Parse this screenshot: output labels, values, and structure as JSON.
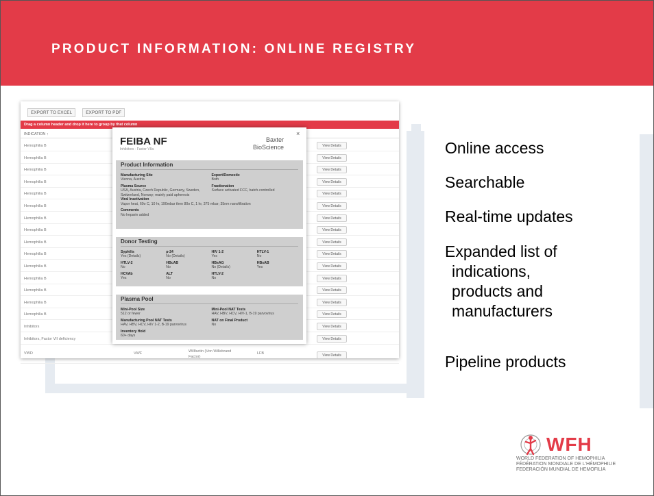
{
  "slide": {
    "title": "PRODUCT INFORMATION: ONLINE REGISTRY",
    "accent_color": "#e33b48"
  },
  "registry": {
    "toolbar": [
      "EXPORT TO EXCEL",
      "EXPORT TO PDF"
    ],
    "group_hint": "Drag a column header and drop it here to group by that column",
    "header": "INDICATION ↑",
    "view_details": "View Details",
    "rows": [
      {
        "indication": "Hemophilia B"
      },
      {
        "indication": "Hemophilia B"
      },
      {
        "indication": "Hemophilia B"
      },
      {
        "indication": "Hemophilia B"
      },
      {
        "indication": "Hemophilia B"
      },
      {
        "indication": "Hemophilia B"
      },
      {
        "indication": "Hemophilia B"
      },
      {
        "indication": "Hemophilia B"
      },
      {
        "indication": "Hemophilia B"
      },
      {
        "indication": "Hemophilia B"
      },
      {
        "indication": "Hemophilia B"
      },
      {
        "indication": "Hemophilia B"
      },
      {
        "indication": "Hemophilia B"
      },
      {
        "indication": "Hemophilia B"
      },
      {
        "indication": "Hemophilia B"
      },
      {
        "indication": "Inhibitors"
      },
      {
        "indication": "Inhibitors, Factor VII deficiency"
      }
    ],
    "last_row": {
      "indication": "VWD",
      "type": "VWF",
      "desc": "Willfactin (Von Willebrand Factor)",
      "maker": "LFB"
    }
  },
  "modal": {
    "close": "×",
    "product": "FEIBA NF",
    "subtitle": "Inhibitors - Factor VIIa",
    "company_line1": "Baxter",
    "company_line2": "BioScience",
    "info": {
      "heading": "Product Information",
      "site_label": "Manufacturing Site",
      "site": "Vienna, Austria",
      "export_label": "Export/Domestic",
      "export": "Both",
      "source_label": "Plasma Source",
      "source": "USA, Austria, Czech Republic, Germany, Sweden, Switzerland, Norway; mainly paid apheresis",
      "fraction_label": "Fractionation",
      "fraction": "Surface activated FCC, batch-controlled",
      "viral_label": "Viral Inactivation",
      "viral": "Vapor heat, 60o C, 10 hr, 190mbar then 80o C, 1 hr, 375 mbar; 35nm nanofiltration",
      "comments_label": "Comments",
      "comments": "No heparin added"
    },
    "donor": {
      "heading": "Donor Testing",
      "items": [
        {
          "label": "Syphilis",
          "value": "Yes (Details)"
        },
        {
          "label": "p-24",
          "value": "No (Details)"
        },
        {
          "label": "HIV 1-2",
          "value": "Yes"
        },
        {
          "label": "HTLV-1",
          "value": "No"
        },
        {
          "label": "HTLV-2",
          "value": "No"
        },
        {
          "label": "HBcAB",
          "value": "No"
        },
        {
          "label": "HBsAG",
          "value": "No (Details)"
        },
        {
          "label": "HBsAB",
          "value": "Yes"
        },
        {
          "label": "HCVAb",
          "value": "Yes"
        },
        {
          "label": "ALT",
          "value": "No"
        },
        {
          "label": "HTLV-2",
          "value": "No"
        },
        {
          "label": "",
          "value": ""
        }
      ]
    },
    "pool": {
      "heading": "Plasma Pool",
      "minipool_label": "Mini-Pool Size",
      "minipool": "512 or fewer",
      "minipool_nat_label": "Mini-Pool NAT Tests",
      "minipool_nat": "HAV, HBV, HCV, HIV-1, B-19 parvovirus",
      "mfg_nat_label": "Manufacturing Pool NAT Tests",
      "mfg_nat": "HAV, HBV, HCV, HIV 1-2, B-19 parvovirus",
      "final_nat_label": "NAT on Final Product",
      "final_nat": "No",
      "hold_label": "Inventory Hold",
      "hold": "60+ days"
    }
  },
  "bullets": {
    "b1": "Online access",
    "b2": "Searchable",
    "b3": "Real-time updates",
    "b4_l1": "Expanded list of",
    "b4_l2": "indications,",
    "b4_l3": "products and",
    "b4_l4": "manufacturers",
    "b5": "Pipeline products"
  },
  "logo": {
    "name": "WFH",
    "line1": "WORLD FEDERATION OF HEMOPHILIA",
    "line2": "FÉDÉRATION MONDIALE DE L'HÉMOPHILIE",
    "line3": "FEDERACIÓN MUNDIAL DE HEMOFILIA"
  }
}
